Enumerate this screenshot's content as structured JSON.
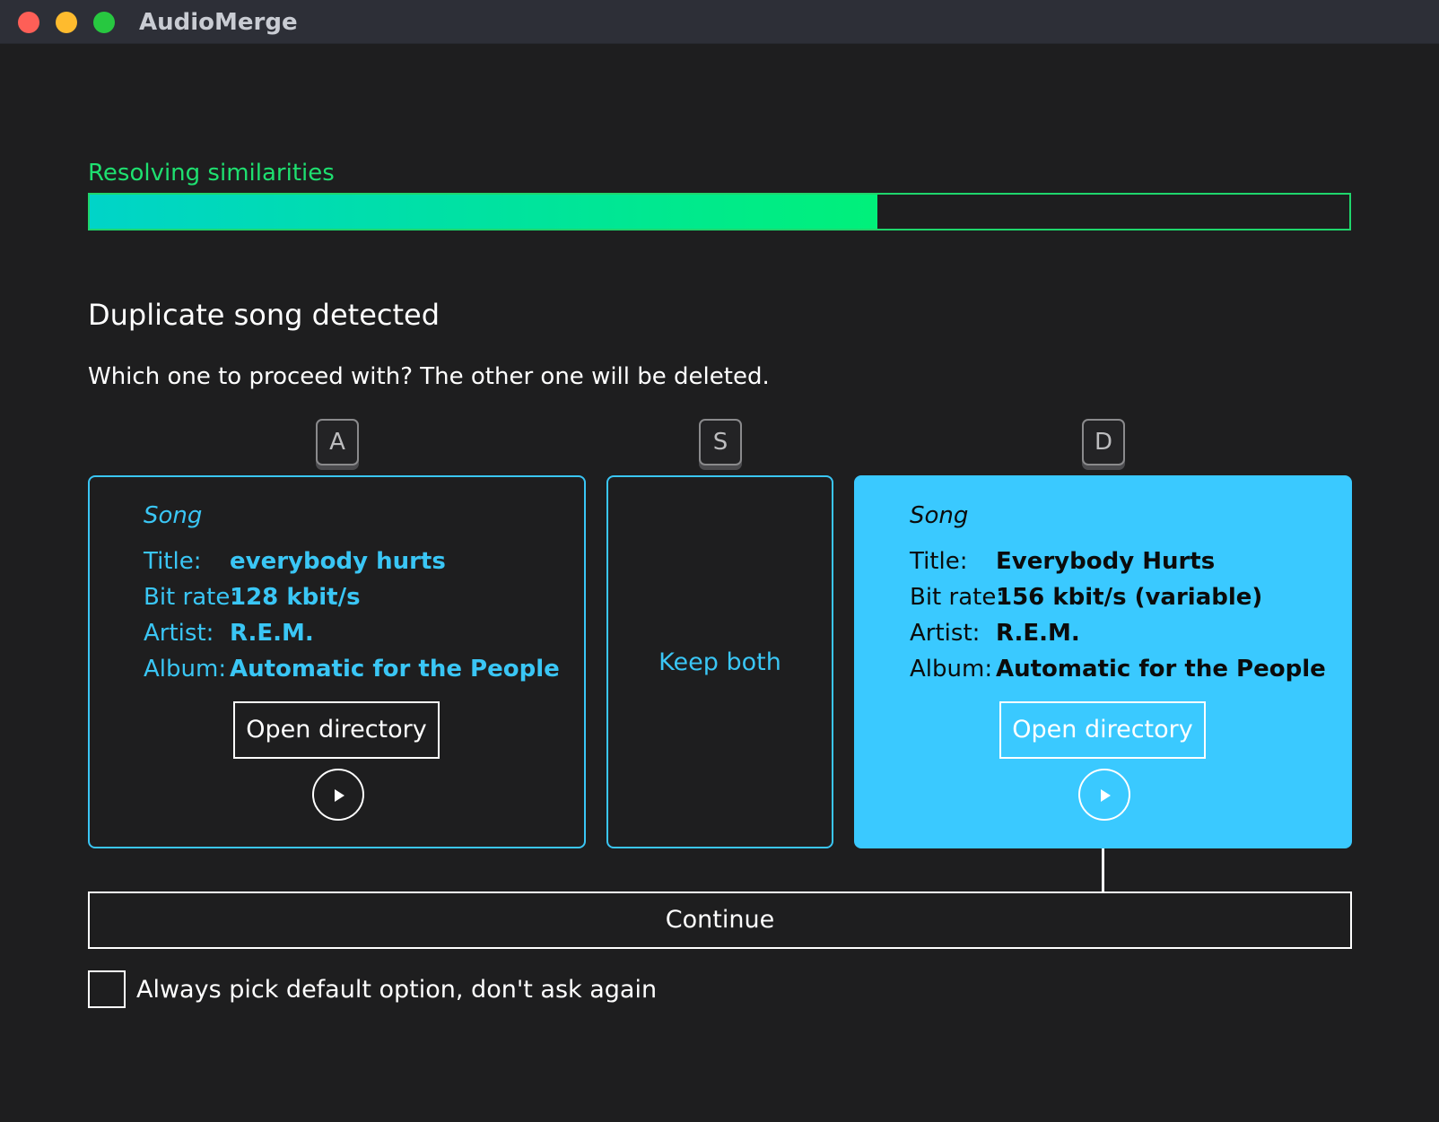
{
  "window": {
    "title": "AudioMerge"
  },
  "progress": {
    "label": "Resolving similarities",
    "fraction": 0.625
  },
  "dialog": {
    "heading": "Duplicate song detected",
    "question": "Which one to proceed with? The other one will be deleted."
  },
  "keys": {
    "a": "A",
    "s": "S",
    "d": "D"
  },
  "options": {
    "a": {
      "section": "Song",
      "title_key": "Title:",
      "title_val": "everybody hurts",
      "bitrate_key": "Bit rate:",
      "bitrate_val": "128 kbit/s",
      "artist_key": "Artist:",
      "artist_val": "R.E.M.",
      "album_key": "Album:",
      "album_val": "Automatic for the People",
      "open_label": "Open directory"
    },
    "s": {
      "label": "Keep both"
    },
    "d": {
      "section": "Song",
      "title_key": "Title:",
      "title_val": "Everybody Hurts",
      "bitrate_key": "Bit rate:",
      "bitrate_val": "156 kbit/s (variable)",
      "artist_key": "Artist:",
      "artist_val": "R.E.M.",
      "album_key": "Album:",
      "album_val": "Automatic for the People",
      "open_label": "Open directory",
      "selected": true
    }
  },
  "actions": {
    "continue_label": "Continue",
    "always_default_label": "Always pick default option, don't ask again"
  },
  "colors": {
    "accent": "#3ac6f5",
    "progress_start": "#00d4c8",
    "progress_end": "#00f07a",
    "progress_label": "#1ee070",
    "background": "#1e1e1f"
  },
  "icons": {
    "play": "play-icon",
    "close": "close-window-icon",
    "minimize": "minimize-window-icon",
    "maximize": "maximize-window-icon"
  }
}
